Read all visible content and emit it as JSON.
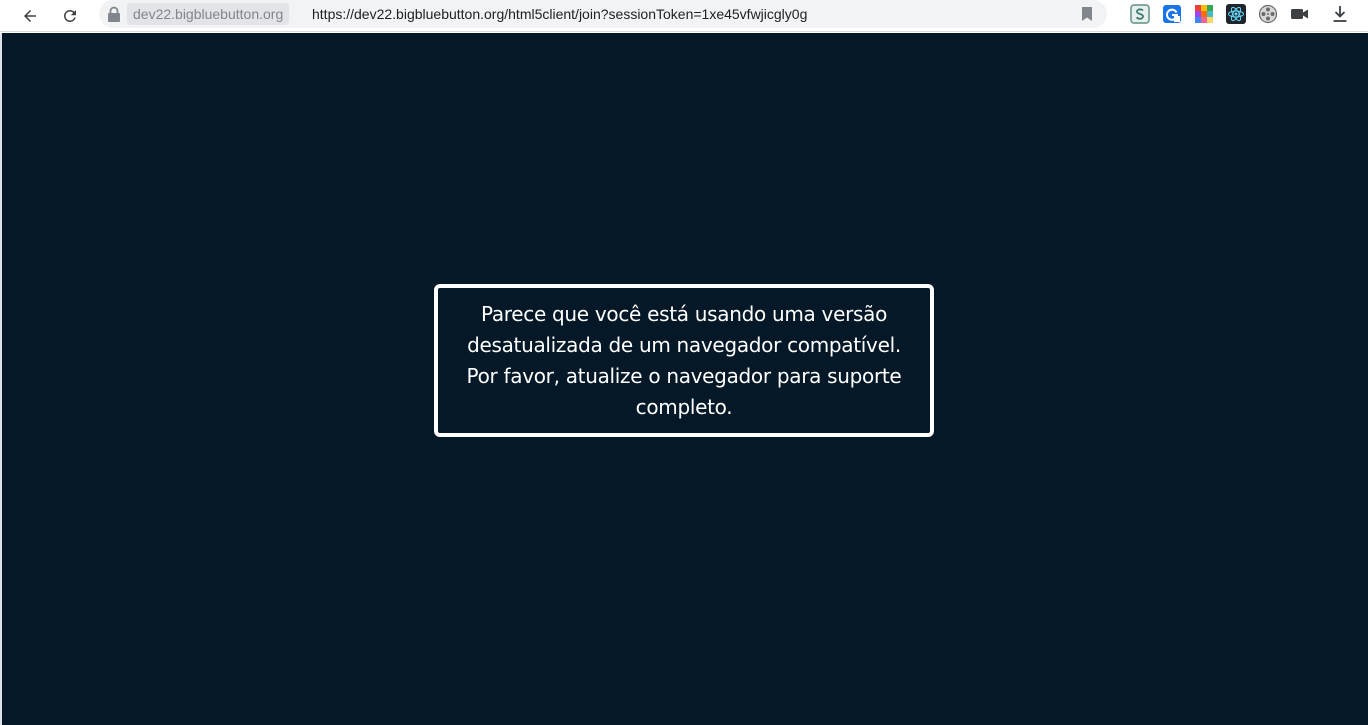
{
  "browser": {
    "origin_chip": "dev22.bigbluebutton.org",
    "url": "https://dev22.bigbluebutton.org/html5client/join?sessionToken=1xe45vfwjicgly0g",
    "icons": {
      "back": "back-arrow-icon",
      "reload": "reload-icon",
      "lock": "lock-icon",
      "bookmark": "bookmark-icon"
    },
    "extensions": [
      {
        "name": "s-extension-icon"
      },
      {
        "name": "g-extension-icon"
      },
      {
        "name": "grid-extension-icon"
      },
      {
        "name": "react-devtools-icon"
      },
      {
        "name": "film-reel-icon"
      },
      {
        "name": "video-camera-icon"
      },
      {
        "name": "download-icon"
      }
    ]
  },
  "page": {
    "background_color": "#041827",
    "notice": {
      "text": "Parece que você está usando uma versão desatualizada de um navegador compatível. Por favor, atualize o navegador para suporte completo.",
      "border_color": "#ffffff"
    }
  }
}
